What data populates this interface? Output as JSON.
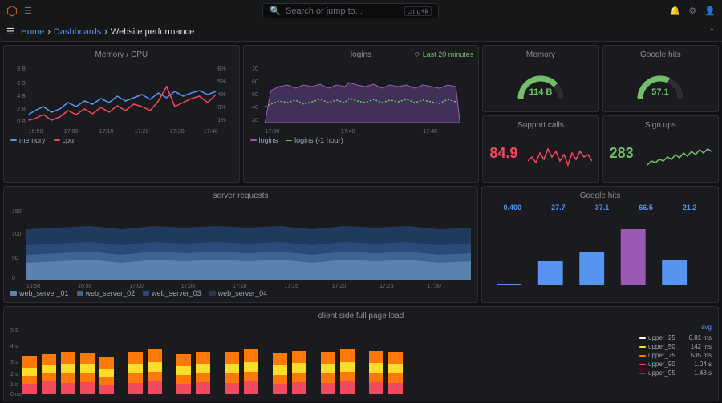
{
  "topbar": {
    "search_placeholder": "Search or jump to...",
    "shortcut": "cmd+k",
    "home": "Home",
    "dashboards": "Dashboards",
    "page_title": "Website performance"
  },
  "panels": {
    "memory_cpu": {
      "title": "Memory / CPU"
    },
    "logins": {
      "title": "logins",
      "time_range": "Last 20 minutes"
    },
    "memory_stat": {
      "title": "Memory",
      "value": "114 B"
    },
    "google_hits_gauge": {
      "title": "Google hits",
      "value": "57.1"
    },
    "support_calls": {
      "title": "Support calls",
      "value": "84.9"
    },
    "sign_ups": {
      "title": "Sign ups",
      "value": "283"
    },
    "server_requests": {
      "title": "server requests"
    },
    "google_hits_bar": {
      "title": "Google hits"
    },
    "client_page_load": {
      "title": "client side full page load"
    }
  },
  "google_hits_values": {
    "a_series": "0.400",
    "b_series": "27.7",
    "c_series": "37.1",
    "d_series": "66.5",
    "e_series": "21.2"
  },
  "legend_server": {
    "items": [
      "web_server_01",
      "web_server_02",
      "web_server_03",
      "web_server_04"
    ]
  },
  "legend_memory_cpu": {
    "items": [
      "memory",
      "cpu"
    ]
  },
  "legend_logins": {
    "items": [
      "logins",
      "logins (-1 hour)"
    ]
  },
  "legend_page_load": {
    "items": [
      {
        "label": "upper_25",
        "val": "6.81 ms"
      },
      {
        "label": "upper_50",
        "val": "142 ms"
      },
      {
        "label": "upper_75",
        "val": "535 ms"
      },
      {
        "label": "upper_90",
        "val": "1.04 s"
      },
      {
        "label": "upper_95",
        "val": "1.48 s"
      }
    ]
  }
}
